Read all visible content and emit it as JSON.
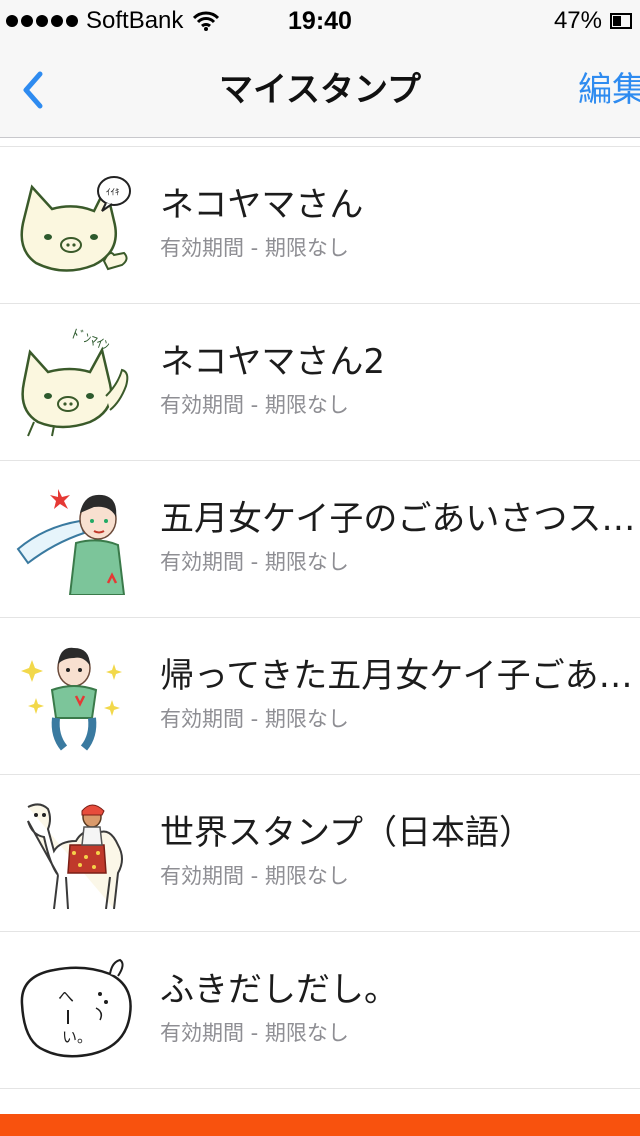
{
  "status": {
    "carrier": "SoftBank",
    "time": "19:40",
    "battery_text": "47%",
    "battery_level": 0.47
  },
  "nav": {
    "back_icon": "chevron-left-icon",
    "title": "マイスタンプ",
    "edit_label": "編集"
  },
  "stickers": [
    {
      "title": "ネコヤマさん",
      "validity": "有効期間 - 期限なし",
      "icon": "cat-thumbs-up-sticker"
    },
    {
      "title": "ネコヤマさん2",
      "validity": "有効期間 - 期限なし",
      "icon": "cat-waving-sticker"
    },
    {
      "title": "五月女ケイ子のごあいさつス…",
      "validity": "有効期間 - 期限なし",
      "icon": "woman-salute-sticker"
    },
    {
      "title": "帰ってきた五月女ケイ子ごあ…",
      "validity": "有効期間 - 期限なし",
      "icon": "woman-sparkle-sticker"
    },
    {
      "title": "世界スタンプ（日本語）",
      "validity": "有効期間 - 期限なし",
      "icon": "camel-rider-sticker"
    },
    {
      "title": "ふきだしだし。",
      "validity": "有効期間 - 期限なし",
      "icon": "speech-bubble-sticker"
    }
  ],
  "colors": {
    "accent": "#2e8bf0",
    "bottom_bar": "#f8520e",
    "subtitle": "#8e8e93"
  }
}
